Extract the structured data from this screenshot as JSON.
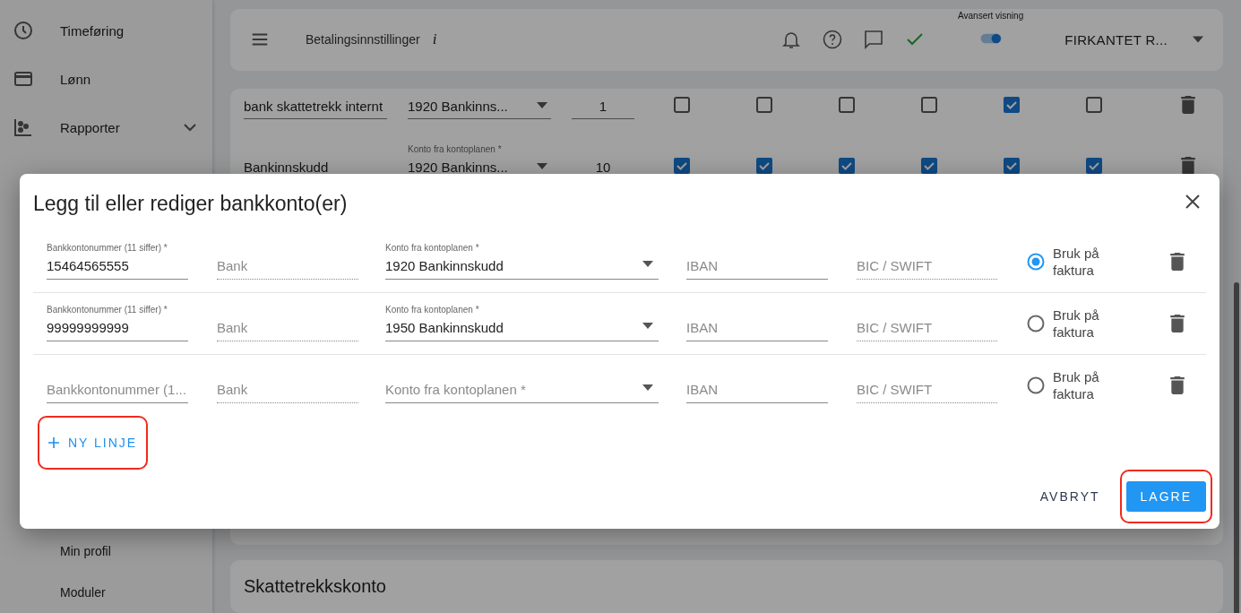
{
  "sidebar": {
    "items": [
      {
        "label": "Timeføring"
      },
      {
        "label": "Lønn"
      },
      {
        "label": "Rapporter",
        "expanded": false
      }
    ],
    "bottom_items": [
      {
        "label": "Min profil"
      },
      {
        "label": "Moduler"
      }
    ]
  },
  "header": {
    "title": "Betalingsinnstillinger",
    "info_icon": "i",
    "advanced_view": {
      "label": "Avansert visning",
      "on": true
    },
    "company": "FIRKANTET R..."
  },
  "table": {
    "rows": [
      {
        "name": "bank skattetrekk internt",
        "account": {
          "value": "1920 Bankinns..."
        },
        "number": "1",
        "checks": [
          {
            "checked": false
          },
          {
            "checked": false
          },
          {
            "checked": false
          },
          {
            "checked": false
          },
          {
            "checked": true
          },
          {
            "checked": false
          }
        ]
      },
      {
        "name": "Bankinnskudd",
        "account": {
          "label": "Konto fra kontoplanen *",
          "value": "1920 Bankinns..."
        },
        "number": "10",
        "checks": [
          {
            "checked": true
          },
          {
            "checked": true
          },
          {
            "checked": true
          },
          {
            "checked": true
          },
          {
            "checked": true
          },
          {
            "checked": true
          }
        ]
      }
    ]
  },
  "tax_account_card": {
    "title": "Skattetrekkskonto"
  },
  "dialog": {
    "title": "Legg til eller rediger bankkonto(er)",
    "rows": [
      {
        "account_number": {
          "label": "Bankkontonummer (11 siffer) *",
          "value": "15464565555"
        },
        "bank": {
          "placeholder": "Bank"
        },
        "ledger_account": {
          "label": "Konto fra kontoplanen *",
          "value": "1920 Bankinnskudd"
        },
        "iban": {
          "placeholder": "IBAN"
        },
        "bic": {
          "placeholder": "BIC / SWIFT"
        },
        "use_on_invoice": {
          "label": "Bruk på faktura",
          "selected": true
        }
      },
      {
        "account_number": {
          "label": "Bankkontonummer (11 siffer) *",
          "value": "99999999999"
        },
        "bank": {
          "placeholder": "Bank"
        },
        "ledger_account": {
          "label": "Konto fra kontoplanen *",
          "value": "1950 Bankinnskudd"
        },
        "iban": {
          "placeholder": "IBAN"
        },
        "bic": {
          "placeholder": "BIC / SWIFT"
        },
        "use_on_invoice": {
          "label": "Bruk på faktura",
          "selected": false
        }
      },
      {
        "account_number": {
          "placeholder": "Bankkontonummer (1..."
        },
        "bank": {
          "placeholder": "Bank"
        },
        "ledger_account": {
          "placeholder": "Konto fra kontoplanen *"
        },
        "iban": {
          "placeholder": "IBAN"
        },
        "bic": {
          "placeholder": "BIC / SWIFT"
        },
        "use_on_invoice": {
          "label": "Bruk på faktura",
          "selected": false
        }
      }
    ],
    "add_line_button": {
      "label": "NY LINJE",
      "highlighted": true
    },
    "cancel_button": {
      "label": "AVBRYT",
      "highlighted": false
    },
    "save_button": {
      "label": "LAGRE",
      "highlighted": true
    }
  }
}
